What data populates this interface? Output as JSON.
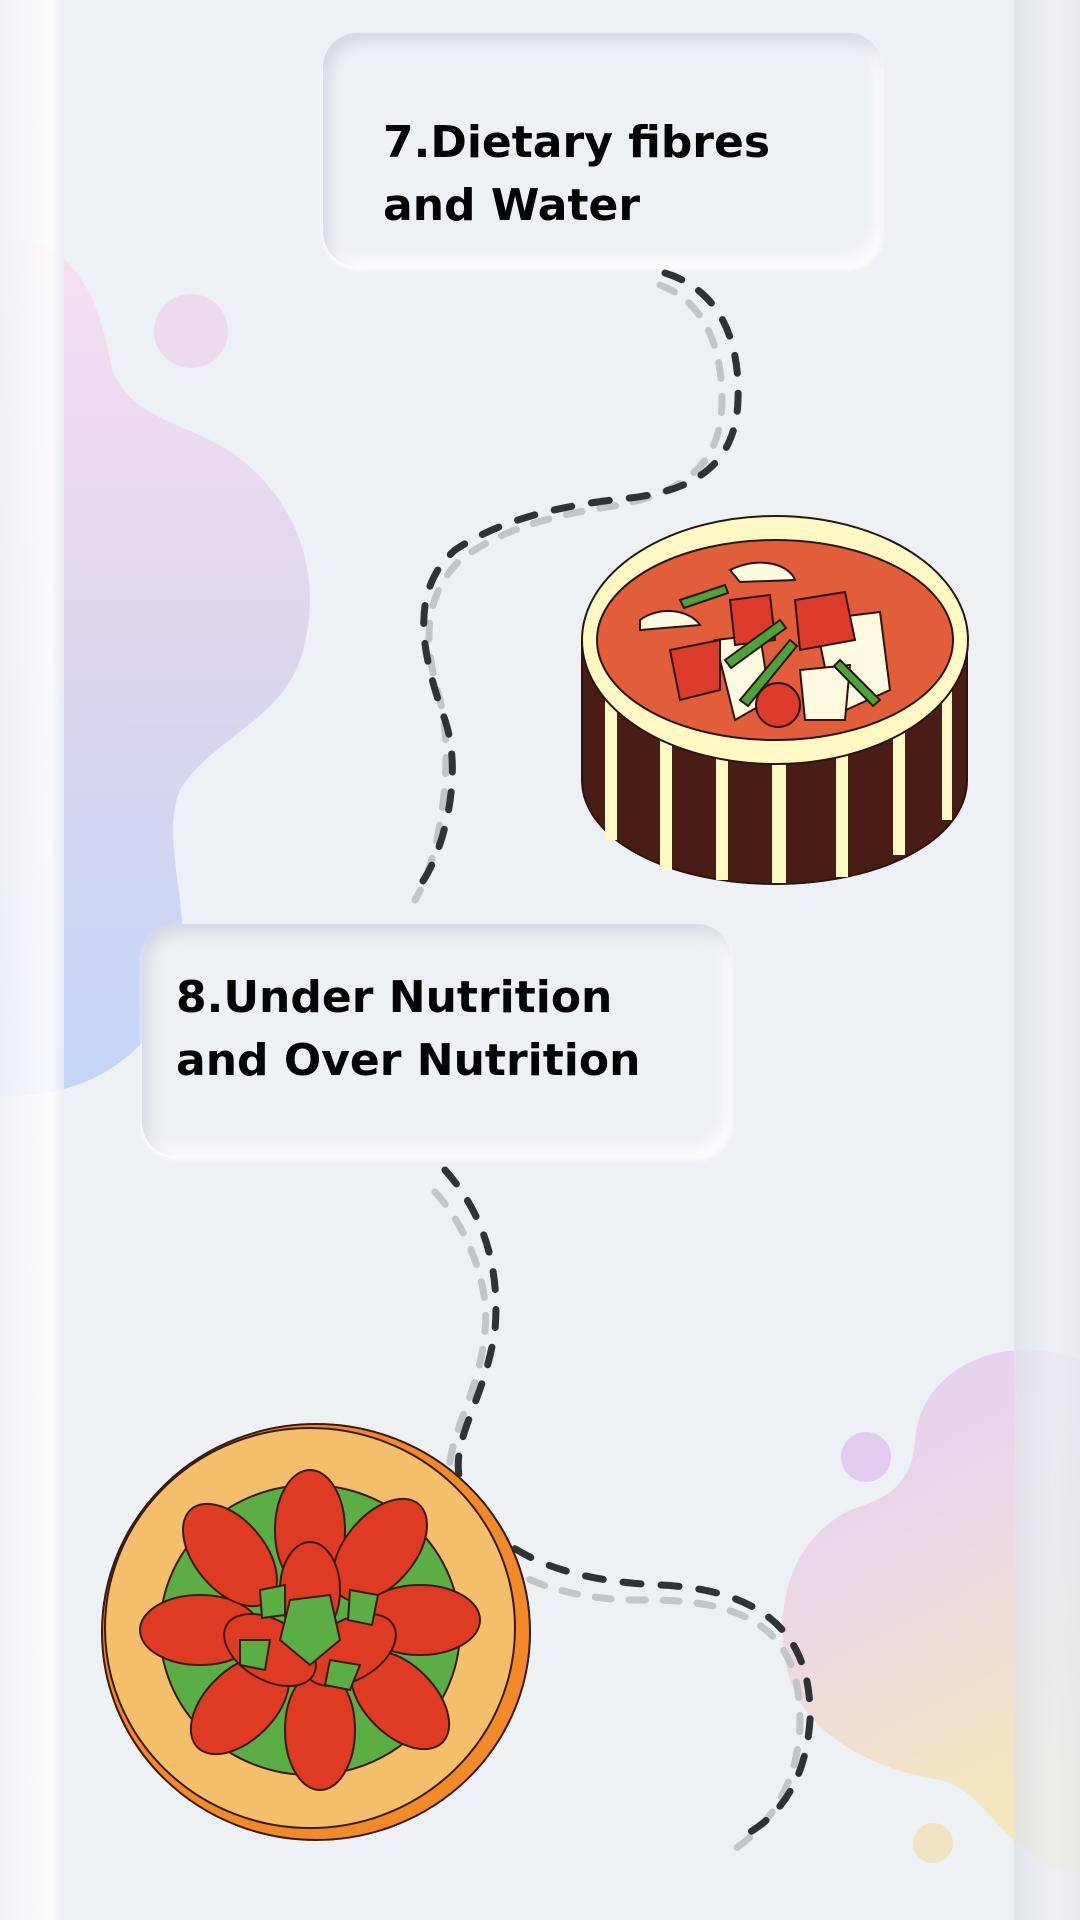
{
  "steps": [
    {
      "label": "7.Dietary fibres and Water",
      "illustration": "curry-bowl"
    },
    {
      "label": "8.Under Nutrition and Over Nutrition",
      "illustration": "crayfish-plate"
    }
  ],
  "colors": {
    "background": "#edf0f4",
    "path_dark": "#2f3237",
    "path_light": "#c2c5ca",
    "blob_pink": "#ecd5ec",
    "blob_blue": "#c5d6f5",
    "blob_yellow": "#f2e4c2"
  }
}
